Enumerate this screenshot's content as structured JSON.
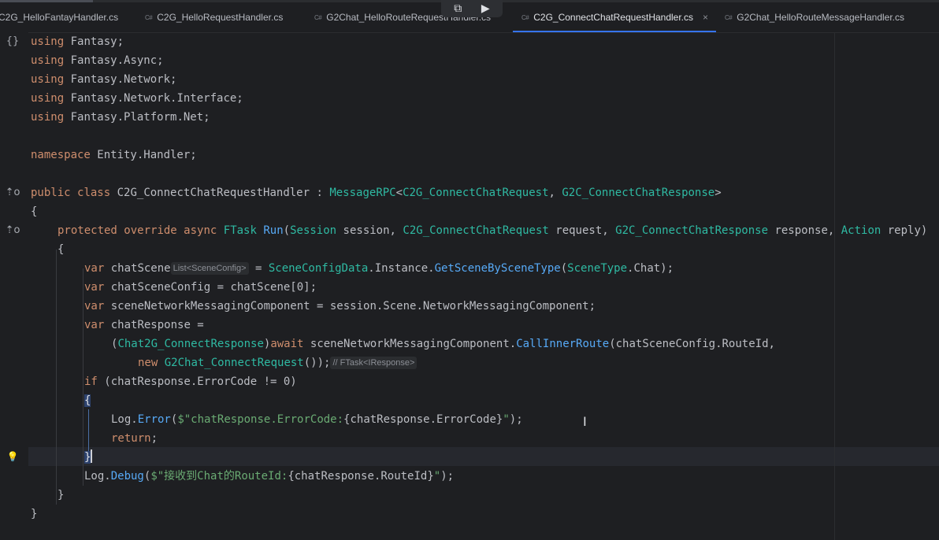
{
  "tabs": [
    {
      "icon": "",
      "label": "C2G_HelloFantayHandler.cs",
      "active": false
    },
    {
      "icon": "C#",
      "label": "C2G_HelloRequestHandler.cs",
      "active": false
    },
    {
      "icon": "C#",
      "label": "G2Chat_HelloRouteRequestHandler.cs",
      "active": false
    },
    {
      "icon": "C#",
      "label": "C2G_ConnectChatRequestHandler.cs",
      "active": true,
      "close": "×"
    },
    {
      "icon": "C#",
      "label": "G2Chat_HelloRouteMessageHandler.cs",
      "active": false
    }
  ],
  "overlay": {
    "left_icon": "⧉",
    "right_icon": "▶"
  },
  "colors": {
    "background": "#1e1f22",
    "keyword": "#cf8e6d",
    "type": "#2fbaa3",
    "function": "#57aaf7",
    "string": "#6aab73",
    "text": "#bcbec4",
    "accent": "#3574f0"
  },
  "gutter": {
    "braces_icon": "{}",
    "implemented_icon": "⇡o",
    "overrides_icon": "⇡o",
    "bulb_icon": "💡"
  },
  "code": {
    "l1": {
      "kw": "using",
      "rest": " Fantasy;"
    },
    "l2": {
      "kw": "using",
      "rest": " Fantasy.Async;"
    },
    "l3": {
      "kw": "using",
      "rest": " Fantasy.Network;"
    },
    "l4": {
      "kw": "using",
      "rest": " Fantasy.Network.Interface;"
    },
    "l5": {
      "kw": "using",
      "rest": " Fantasy.Platform.Net;"
    },
    "l7": {
      "kw": "namespace",
      "rest": " Entity.Handler;"
    },
    "l9": {
      "kw1": "public",
      "kw2": "class",
      "name": " C2G_ConnectChatRequestHandler : ",
      "base": "MessageRPC",
      "lt": "<",
      "t1": "C2G_ConnectChatRequest",
      "comma": ", ",
      "t2": "G2C_ConnectChatResponse",
      "gt": ">"
    },
    "l10": "{",
    "l11": {
      "kw1": "protected",
      "kw2": "override",
      "kw3": "async",
      "t0": "FTask",
      "fn": "Run",
      "p0": "(",
      "t1": "Session",
      "a1": " session, ",
      "t2": "C2G_ConnectChatRequest",
      "a2": " request, ",
      "t3": "G2C_ConnectChatResponse",
      "a3": " response, ",
      "t4": "Action",
      "a4": " reply)"
    },
    "l12": "{",
    "l13": {
      "kw": "var",
      "name": " chatScene",
      "hint": "List<SceneConfig>",
      "eq": " = ",
      "t1": "SceneConfigData",
      "mid": ".Instance.",
      "fn": "GetSceneBySceneType",
      "p": "(",
      "t2": "SceneType",
      "end": ".Chat);"
    },
    "l14": {
      "kw": "var",
      "rest": " chatSceneConfig = chatScene[0];"
    },
    "l15": {
      "kw": "var",
      "rest": " sceneNetworkMessagingComponent = session.Scene.NetworkMessagingComponent;"
    },
    "l16": {
      "kw": "var",
      "rest": " chatResponse ="
    },
    "l17": {
      "p": "(",
      "t1": "Chat2G_ConnectResponse",
      "p2": ")",
      "kw": "await",
      "mid": " sceneNetworkMessagingComponent.",
      "fn": "CallInnerRoute",
      "end": "(chatSceneConfig.RouteId,"
    },
    "l18": {
      "kw": "new",
      "t1": " G2Chat_ConnectRequest",
      "end": "());",
      "hint": "// FTask<IResponse>"
    },
    "l19": {
      "kw": "if",
      "rest": " (chatResponse.ErrorCode != 0)"
    },
    "l20": "{",
    "l21": {
      "obj": "Log.",
      "fn": "Error",
      "p": "(",
      "s1": "$\"chatResponse.ErrorCode:",
      "interp": "{chatResponse.ErrorCode}",
      "s2": "\"",
      "end": ");"
    },
    "l22": {
      "kw": "return",
      "rest": ";"
    },
    "l23": "}",
    "l24": {
      "obj": "Log.",
      "fn": "Debug",
      "p": "(",
      "s1": "$\"接收到Chat的RouteId:",
      "interp": "{chatResponse.RouteId}",
      "s2": "\"",
      "end": ");"
    },
    "l25": "}",
    "l26": "}"
  }
}
